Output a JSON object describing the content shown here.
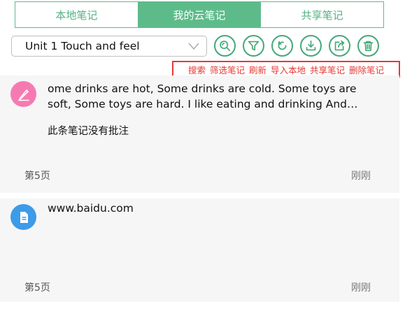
{
  "tabs": [
    {
      "label": "本地笔记",
      "active": false
    },
    {
      "label": "我的云笔记",
      "active": true
    },
    {
      "label": "共享笔记",
      "active": false
    }
  ],
  "unit_select": {
    "value": "Unit 1 Touch and feel"
  },
  "toolbar": {
    "icons": [
      "search-icon",
      "filter-icon",
      "refresh-icon",
      "download-icon",
      "share-icon",
      "trash-icon"
    ]
  },
  "legend": {
    "search": "搜索",
    "filter": "筛选笔记",
    "refresh": "刷新",
    "import": "导入本地",
    "share": "共享笔记",
    "delete": "删除笔记"
  },
  "notes": [
    {
      "icon": "pen-icon",
      "text": "ome drinks are hot, Some drinks are cold. Some toys are soft, Some toys are hard. I like eating and drinking And playing in the park.",
      "comment": "此条笔记没有批注",
      "page": "第5页",
      "time": "刚刚"
    },
    {
      "icon": "document-icon",
      "text": "www.baidu.com",
      "page": "第5页",
      "time": "刚刚"
    }
  ],
  "colors": {
    "accent": "#5dbb8a",
    "toolbar_icon": "#45a879",
    "legend_red": "#e53935",
    "note_bg": "#f6f6f6",
    "pen_avatar": "#f67ab2",
    "doc_avatar": "#3d9be8"
  }
}
